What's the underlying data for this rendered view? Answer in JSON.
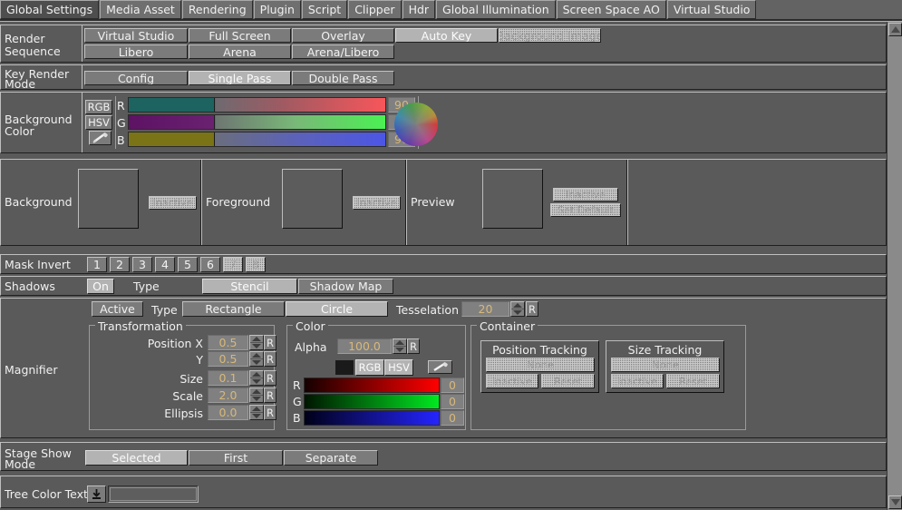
{
  "window": {
    "title": "Global Settings"
  },
  "colors": {
    "panel_bg": "#5a5a5a",
    "button_bg": "#7b7b7b",
    "button_selected_bg": "#b3b3b3",
    "value_text": "#d8b878",
    "border_light": "#bfbfbf",
    "border_dark": "#1f1f1f",
    "tab_active_bg": "#4e4e4e"
  },
  "tabs": [
    {
      "label": "Global Settings",
      "active": true
    },
    {
      "label": "Media Asset",
      "active": false
    },
    {
      "label": "Rendering",
      "active": false
    },
    {
      "label": "Plugin",
      "active": false
    },
    {
      "label": "Script",
      "active": false
    },
    {
      "label": "Clipper",
      "active": false
    },
    {
      "label": "Hdr",
      "active": false
    },
    {
      "label": "Global Illumination",
      "active": false
    },
    {
      "label": "Screen Space AO",
      "active": false
    },
    {
      "label": "Virtual Studio",
      "active": false
    }
  ],
  "render_sequence": {
    "label": "Render\nSequence",
    "label_line1": "Render",
    "label_line2": "Sequence",
    "row1": [
      {
        "label": "Virtual Studio",
        "state": "normal"
      },
      {
        "label": "Full Screen",
        "state": "normal"
      },
      {
        "label": "Overlay",
        "state": "normal"
      },
      {
        "label": "Auto Key",
        "state": "selected"
      },
      {
        "label": "Background Image",
        "state": "disabled"
      }
    ],
    "row2": [
      {
        "label": "Libero",
        "state": "normal"
      },
      {
        "label": "Arena",
        "state": "normal"
      },
      {
        "label": "Arena/Libero",
        "state": "normal"
      }
    ]
  },
  "key_render_mode": {
    "label_line1": "Key Render",
    "label_line2": "Mode",
    "buttons": [
      {
        "label": "Config",
        "state": "normal"
      },
      {
        "label": "Single Pass",
        "state": "selected"
      },
      {
        "label": "Double Pass",
        "state": "normal"
      }
    ]
  },
  "background_color": {
    "label_line1": "Background",
    "label_line2": "Color",
    "mode_buttons": [
      {
        "label": "RGB",
        "state": "normal"
      },
      {
        "label": "HSV",
        "state": "normal"
      }
    ],
    "eyedropper_icon": "eyedropper-icon",
    "channels": [
      {
        "name": "R",
        "value": "90",
        "from": "#1d6360",
        "mid": "#7a6d6d",
        "to": "#f7565a"
      },
      {
        "name": "G",
        "value": "90",
        "from": "#5d1263",
        "mid": "#77897a",
        "to": "#4bf053"
      },
      {
        "name": "B",
        "value": "90",
        "from": "#7a7416",
        "mid": "#6c7292",
        "to": "#4c56e6"
      }
    ],
    "wheel_icon": "color-wheel"
  },
  "preview_panels": [
    {
      "label": "Background",
      "buttons": [
        {
          "label": "Inactive",
          "state": "disabled"
        }
      ]
    },
    {
      "label": "Foreground",
      "buttons": [
        {
          "label": "Inactive",
          "state": "disabled"
        }
      ]
    },
    {
      "label": "Preview",
      "buttons": [
        {
          "label": "Inactive",
          "state": "disabled"
        },
        {
          "label": "Set Default",
          "state": "disabled"
        }
      ]
    }
  ],
  "mask_invert": {
    "label": "Mask Invert",
    "buttons": [
      {
        "label": "1",
        "state": "normal"
      },
      {
        "label": "2",
        "state": "normal"
      },
      {
        "label": "3",
        "state": "normal"
      },
      {
        "label": "4",
        "state": "normal"
      },
      {
        "label": "5",
        "state": "normal"
      },
      {
        "label": "6",
        "state": "normal"
      },
      {
        "label": "7",
        "state": "disabled"
      },
      {
        "label": "8",
        "state": "disabled"
      }
    ]
  },
  "shadows": {
    "label": "Shadows",
    "on_button": {
      "label": "On",
      "state": "selected"
    },
    "type_label": "Type",
    "type_buttons": [
      {
        "label": "Stencil",
        "state": "selected"
      },
      {
        "label": "Shadow Map",
        "state": "normal"
      }
    ]
  },
  "magnifier": {
    "label": "Magnifier",
    "active_button": {
      "label": "Active",
      "state": "normal"
    },
    "type_label": "Type",
    "type_buttons": [
      {
        "label": "Rectangle",
        "state": "normal"
      },
      {
        "label": "Circle",
        "state": "selected"
      }
    ],
    "tesselation": {
      "label": "Tesselation",
      "value": "20",
      "reset": "R"
    },
    "transformation": {
      "legend": "Transformation",
      "fields": [
        {
          "label": "Position X",
          "value": "0.5",
          "reset": "R"
        },
        {
          "label": "Y",
          "value": "0.5",
          "reset": "R"
        },
        {
          "label": "Size",
          "value": "0.1",
          "reset": "R"
        },
        {
          "label": "Scale",
          "value": "2.0",
          "reset": "R"
        },
        {
          "label": "Ellipsis",
          "value": "0.0",
          "reset": "R"
        }
      ]
    },
    "color": {
      "legend": "Color",
      "alpha": {
        "label": "Alpha",
        "value": "100.0",
        "reset": "R"
      },
      "swatch_color": "#1a1a1a",
      "mode_buttons": [
        {
          "label": "RGB",
          "state": "selected"
        },
        {
          "label": "HSV",
          "state": "selected"
        }
      ],
      "eyedropper_icon": "eyedropper-icon",
      "channels": [
        {
          "name": "R",
          "value": "0",
          "to": "#ff0000"
        },
        {
          "name": "G",
          "value": "0",
          "to": "#00e000"
        },
        {
          "name": "B",
          "value": "0",
          "to": "#2020ff"
        }
      ]
    },
    "container": {
      "legend": "Container",
      "groups": [
        {
          "title": "Position Tracking",
          "main": {
            "label": "None",
            "state": "disabled"
          },
          "buttons": [
            {
              "label": "Inactive",
              "state": "disabled"
            },
            {
              "label": "Reset",
              "state": "disabled"
            }
          ]
        },
        {
          "title": "Size Tracking",
          "main": {
            "label": "None",
            "state": "disabled"
          },
          "buttons": [
            {
              "label": "Inactive",
              "state": "disabled"
            },
            {
              "label": "Reset",
              "state": "disabled"
            }
          ]
        }
      ]
    }
  },
  "stage_show_mode": {
    "label_line1": "Stage Show",
    "label_line2": "Mode",
    "buttons": [
      {
        "label": "Selected",
        "state": "selected"
      },
      {
        "label": "First",
        "state": "normal"
      },
      {
        "label": "Separate",
        "state": "normal"
      }
    ]
  },
  "tree_color_text": {
    "label": "Tree Color Text",
    "dropdown_icon": "download-arrow-icon",
    "input_value": "",
    "input_placeholder": ""
  },
  "scrollbar": {
    "up_icon": "scroll-up-arrow-icon",
    "down_icon": "scroll-down-arrow-icon"
  }
}
